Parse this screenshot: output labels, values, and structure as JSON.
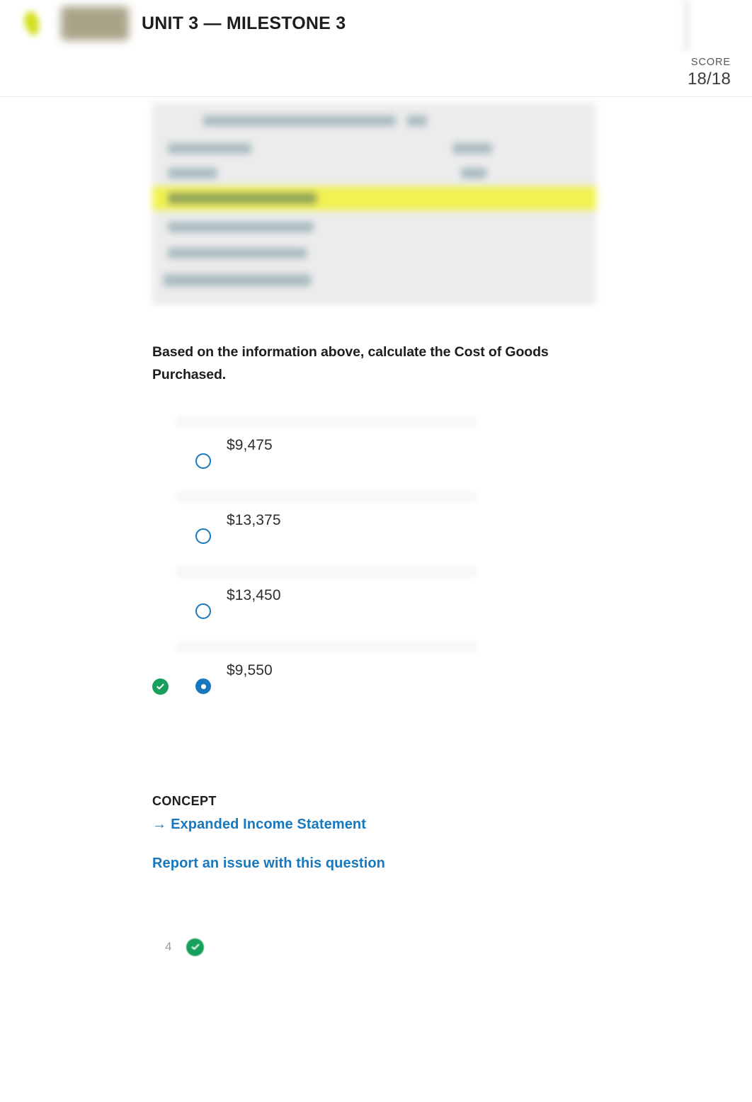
{
  "header": {
    "logo_mark_icon": "leaf-logo-icon",
    "logo_wordmark_icon": "brand-wordmark-icon",
    "title": "UNIT 3 — MILESTONE 3",
    "score_label": "SCORE",
    "score_value": "18/18",
    "accent_blue": "#1878bd",
    "accent_green": "#17a05c",
    "divider_color": "#ececec"
  },
  "stimulus": {
    "alt": "blurred accounting table with one highlighted row",
    "background": "#ececec",
    "highlight_color": "#f2f23c",
    "row_count": 7
  },
  "question": {
    "prompt": "Based on the information above, calculate the Cost of Goods Purchased.",
    "options": [
      {
        "label": "$9,475",
        "selected": false,
        "correct": false
      },
      {
        "label": "$13,375",
        "selected": false,
        "correct": false
      },
      {
        "label": "$13,450",
        "selected": false,
        "correct": false
      },
      {
        "label": "$9,550",
        "selected": true,
        "correct": true
      }
    ]
  },
  "concept": {
    "label": "CONCEPT",
    "arrow_icon": "arrow-right-icon",
    "link_text": "Expanded Income Statement",
    "report_text": "Report an issue with this question"
  },
  "footer": {
    "question_number": "4",
    "status_icon": "check-circle-icon"
  }
}
